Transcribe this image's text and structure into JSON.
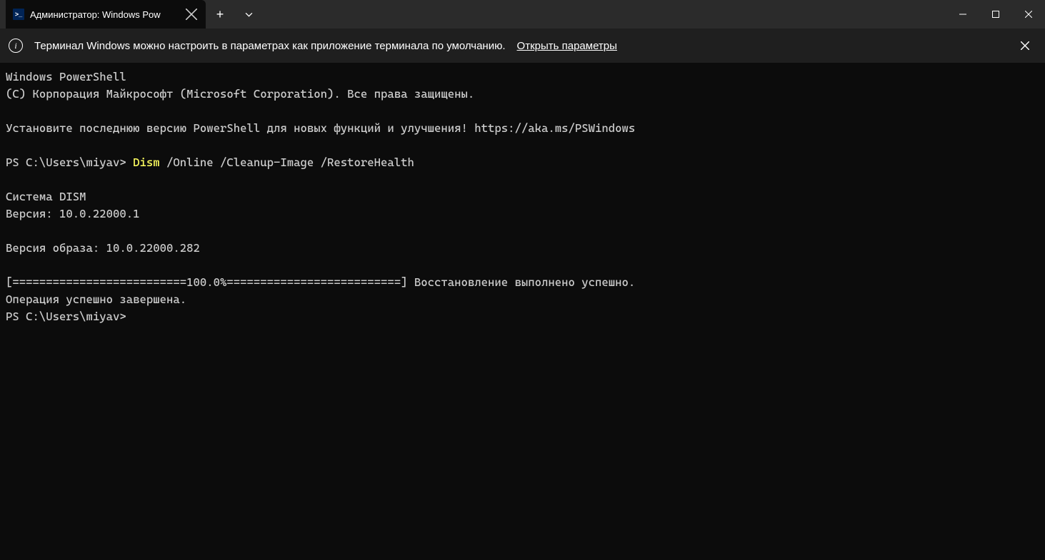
{
  "tab": {
    "title": "Администратор: Windows Pow"
  },
  "infobar": {
    "message": "Терминал Windows можно настроить в параметрах как приложение терминала по умолчанию.",
    "link": "Открыть параметры"
  },
  "terminal": {
    "line1": "Windows PowerShell",
    "line2": "(C) Корпорация Майкрософт (Microsoft Corporation). Все права защищены.",
    "line3": "",
    "line4": "Установите последнюю версию PowerShell для новых функций и улучшения! https://aka.ms/PSWindows",
    "line5": "",
    "prompt1_pre": "PS C:\\Users\\miyav> ",
    "cmd": "Dism",
    "prompt1_post": " /Online /Cleanup-Image /RestoreHealth",
    "line7": "",
    "line8": "Cистема DISM",
    "line9": "Версия: 10.0.22000.1",
    "line10": "",
    "line11": "Версия образа: 10.0.22000.282",
    "line12": "",
    "line13": "[==========================100.0%==========================] Восстановление выполнено успешно.",
    "line14": "Операция успешно завершена.",
    "prompt2": "PS C:\\Users\\miyav>"
  }
}
